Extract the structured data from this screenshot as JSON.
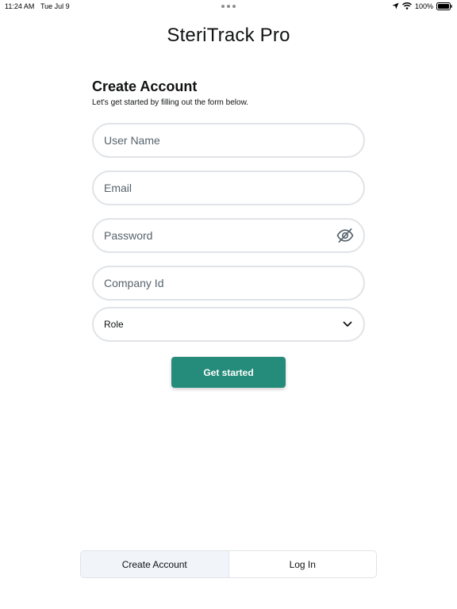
{
  "status_bar": {
    "time": "11:24 AM",
    "date": "Tue Jul 9",
    "battery": "100%",
    "icons": [
      "location-icon",
      "wifi-icon",
      "battery-icon"
    ]
  },
  "app": {
    "title": "SteriTrack Pro"
  },
  "form": {
    "title": "Create Account",
    "subtitle": "Let's get started by filling out the form below.",
    "username_placeholder": "User Name",
    "email_placeholder": "Email",
    "password_placeholder": "Password",
    "password_icon": "eye-off-icon",
    "company_placeholder": "Company Id",
    "role_value": "Role",
    "role_icon": "chevron-down-icon",
    "submit_label": "Get started"
  },
  "tabs": [
    {
      "label": "Create Account",
      "active": true
    },
    {
      "label": "Log In",
      "active": false
    }
  ],
  "colors": {
    "primary": "#258b7a",
    "field_border": "#e0e3e7",
    "active_tab_bg": "#f1f4f8",
    "text": "#101213",
    "placeholder": "#57636c"
  }
}
